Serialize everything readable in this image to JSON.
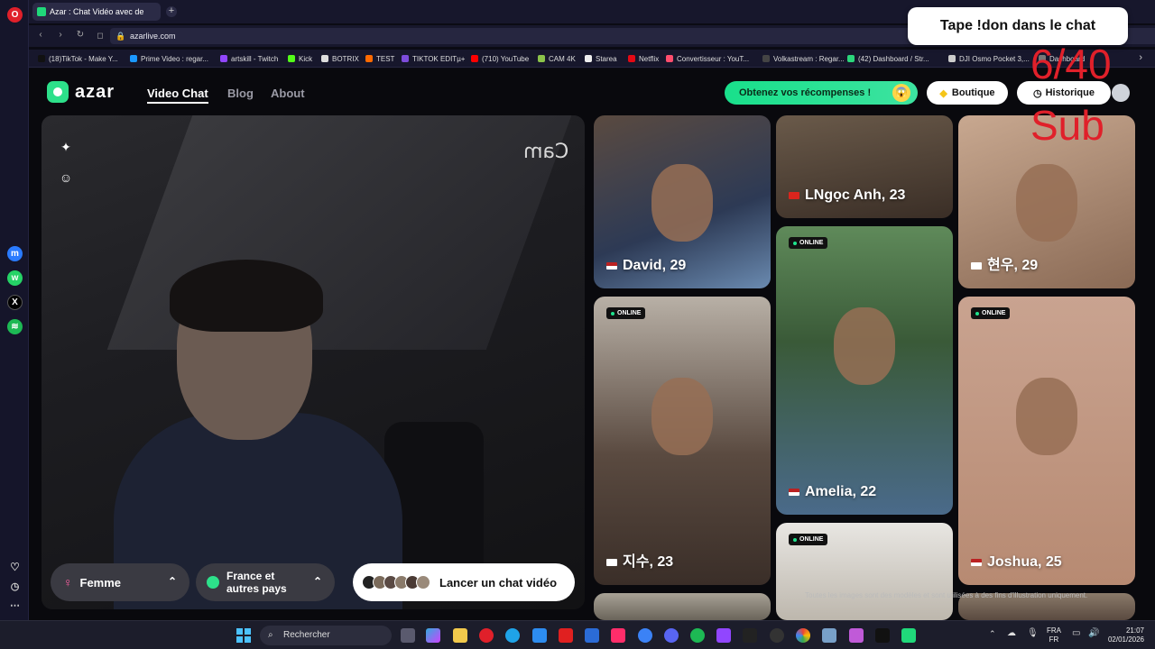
{
  "browser": {
    "tab_title": "Azar : Chat Vidéo avec de",
    "new_tab_symbol": "+",
    "url": "azarlive.com",
    "bookmarks": [
      {
        "label": "(18)TikTok - Make Y...",
        "color": "#111111"
      },
      {
        "label": "Prime Video : regar...",
        "color": "#1a98ff"
      },
      {
        "label": "artskill - Twitch",
        "color": "#9146ff"
      },
      {
        "label": "Kick",
        "color": "#53fc18"
      },
      {
        "label": "BOTRIX",
        "color": "#dddddd"
      },
      {
        "label": "TEST",
        "color": "#ff6a00"
      },
      {
        "label": "TIKTOK EDITµ+",
        "color": "#7d4cdb"
      },
      {
        "label": "(710) YouTube",
        "color": "#ff0000"
      },
      {
        "label": "CAM 4K",
        "color": "#8bc34a"
      },
      {
        "label": "Starea",
        "color": "#eeeeee"
      },
      {
        "label": "Netflix",
        "color": "#e50914"
      },
      {
        "label": "Convertisseur : YouT...",
        "color": "#ff4d6d"
      },
      {
        "label": "Volkastream : Regar...",
        "color": "#444444"
      },
      {
        "label": "(42) Dashboard / Str...",
        "color": "#2bd67b"
      },
      {
        "label": "DJI Osmo Pocket 3,...",
        "color": "#cccccc"
      },
      {
        "label": "Dashboard",
        "color": "#777777"
      }
    ]
  },
  "header": {
    "logo": "azar",
    "nav": [
      "Video Chat",
      "Blog",
      "About"
    ],
    "rewards_label": "Obtenez vos récompenses !",
    "rewards_emoji": "😱",
    "boutique_label": "Boutique",
    "historique_label": "Historique"
  },
  "webcam": {
    "mirror_text": "Cam",
    "gender_label": "Femme",
    "country_label_1": "France et",
    "country_label_2": "autres pays",
    "launch_label": "Lancer un chat vidéo"
  },
  "cards": [
    {
      "name": "David, 29",
      "online": false,
      "flag": "us"
    },
    {
      "name": "LNgọc Anh, 23",
      "online": false,
      "flag": "vn"
    },
    {
      "name": "현우, 29",
      "online": false,
      "flag": "kr"
    },
    {
      "name": "지수, 23",
      "online": true,
      "flag": "kr"
    },
    {
      "name": "Amelia, 22",
      "online": true,
      "flag": "us"
    },
    {
      "name": "Joshua, 25",
      "online": true,
      "flag": "us"
    },
    {
      "name": "",
      "online": true,
      "flag": ""
    }
  ],
  "online_label": "ONLINE",
  "disclaimer": "Toutes les images sont des modèles et sont utilisées à des fins d'illustration uniquement.",
  "overlay": {
    "message": "Tape !don dans le chat",
    "counter": "6/40",
    "sub_label": "Sub"
  },
  "taskbar": {
    "search_placeholder": "Rechercher",
    "lang_1": "FRA",
    "lang_2": "FR",
    "time": "21:07",
    "date": "02/01/2026"
  },
  "colors": {
    "accent": "#20d97a",
    "counter_red": "#e0202a",
    "online_dot": "#1ee38d"
  }
}
